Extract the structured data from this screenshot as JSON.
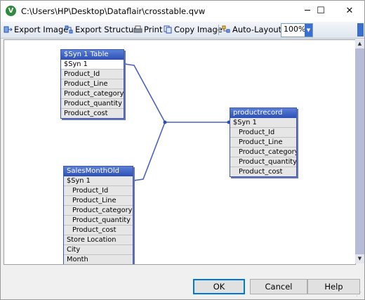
{
  "window": {
    "title": "C:\\Users\\HP\\Desktop\\Dataflair\\crosstable.qvw",
    "app_icon_letter": "V",
    "minimize": "─",
    "maximize": "☐",
    "close": "✕"
  },
  "toolbar": {
    "export_image": "Export Image",
    "export_structure": "Export Structure",
    "print": "Print",
    "copy_image": "Copy Image",
    "auto_layout": "Auto-Layout",
    "zoom": "100%"
  },
  "tables": {
    "syn": {
      "title": "$Syn 1 Table",
      "fields": [
        "$Syn 1",
        "Product_Id",
        "Product_Line",
        "Product_category",
        "Product_quantity",
        "Product_cost"
      ]
    },
    "sales": {
      "title": "SalesMonthOld",
      "fields": [
        "$Syn 1",
        "Product_Id",
        "Product_Line",
        "Product_category",
        "Product_quantity",
        "Product_cost",
        "Store Location",
        "City",
        "Month"
      ]
    },
    "product": {
      "title": "productrecord",
      "fields": [
        "$Syn 1",
        "Product_Id",
        "Product_Line",
        "Product_category",
        "Product_quantity",
        "Product_cost"
      ]
    }
  },
  "buttons": {
    "ok": "OK",
    "cancel": "Cancel",
    "help": "Help"
  },
  "colors": {
    "accent": "#0078d7",
    "table_header": "#2c4fb6",
    "link_line": "#4a62c0"
  }
}
